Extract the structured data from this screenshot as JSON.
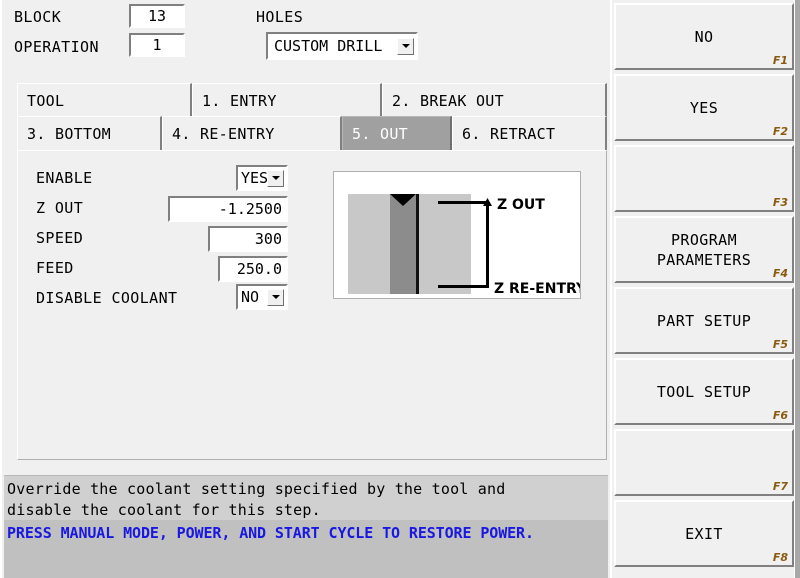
{
  "header": {
    "block_label": "BLOCK",
    "block_value": "13",
    "operation_label": "OPERATION",
    "operation_value": "1",
    "holes_label": "HOLES",
    "holes_value": "CUSTOM DRILL"
  },
  "tabs": {
    "row1": [
      {
        "label": "TOOL",
        "selected": false
      },
      {
        "label": "1. ENTRY",
        "selected": false
      },
      {
        "label": "2. BREAK OUT",
        "selected": false
      }
    ],
    "row2": [
      {
        "label": "3. BOTTOM",
        "selected": false
      },
      {
        "label": "4. RE-ENTRY",
        "selected": false
      },
      {
        "label": "5. OUT",
        "selected": true
      },
      {
        "label": "6. RETRACT",
        "selected": false
      }
    ]
  },
  "form": {
    "enable_label": "ENABLE",
    "enable_value": "YES",
    "zout_label": "Z OUT",
    "zout_value": "-1.2500",
    "speed_label": "SPEED",
    "speed_value": "300",
    "feed_label": "FEED",
    "feed_value": "250.0",
    "coolant_label": "DISABLE COOLANT",
    "coolant_value": "NO"
  },
  "diagram": {
    "label_top": "Z OUT",
    "label_bottom": "Z RE-ENTRY",
    "workpiece_color": "#c8c8c8",
    "hole_color": "#8c8c8c"
  },
  "help": {
    "line1": "Override the coolant setting specified by the tool and",
    "line2": "disable the coolant for this step."
  },
  "status": {
    "message": "PRESS MANUAL MODE, POWER, AND START CYCLE TO RESTORE POWER.",
    "color": "#1818e0"
  },
  "sidebar": {
    "keys": [
      {
        "label": "NO",
        "tag": "F1"
      },
      {
        "label": "YES",
        "tag": "F2"
      },
      {
        "label": "",
        "tag": "F3"
      },
      {
        "label": "PROGRAM\nPARAMETERS",
        "tag": "F4"
      },
      {
        "label": "PART SETUP",
        "tag": "F5"
      },
      {
        "label": "TOOL SETUP",
        "tag": "F6"
      },
      {
        "label": "",
        "tag": "F7"
      },
      {
        "label": "EXIT",
        "tag": "F8"
      }
    ]
  }
}
